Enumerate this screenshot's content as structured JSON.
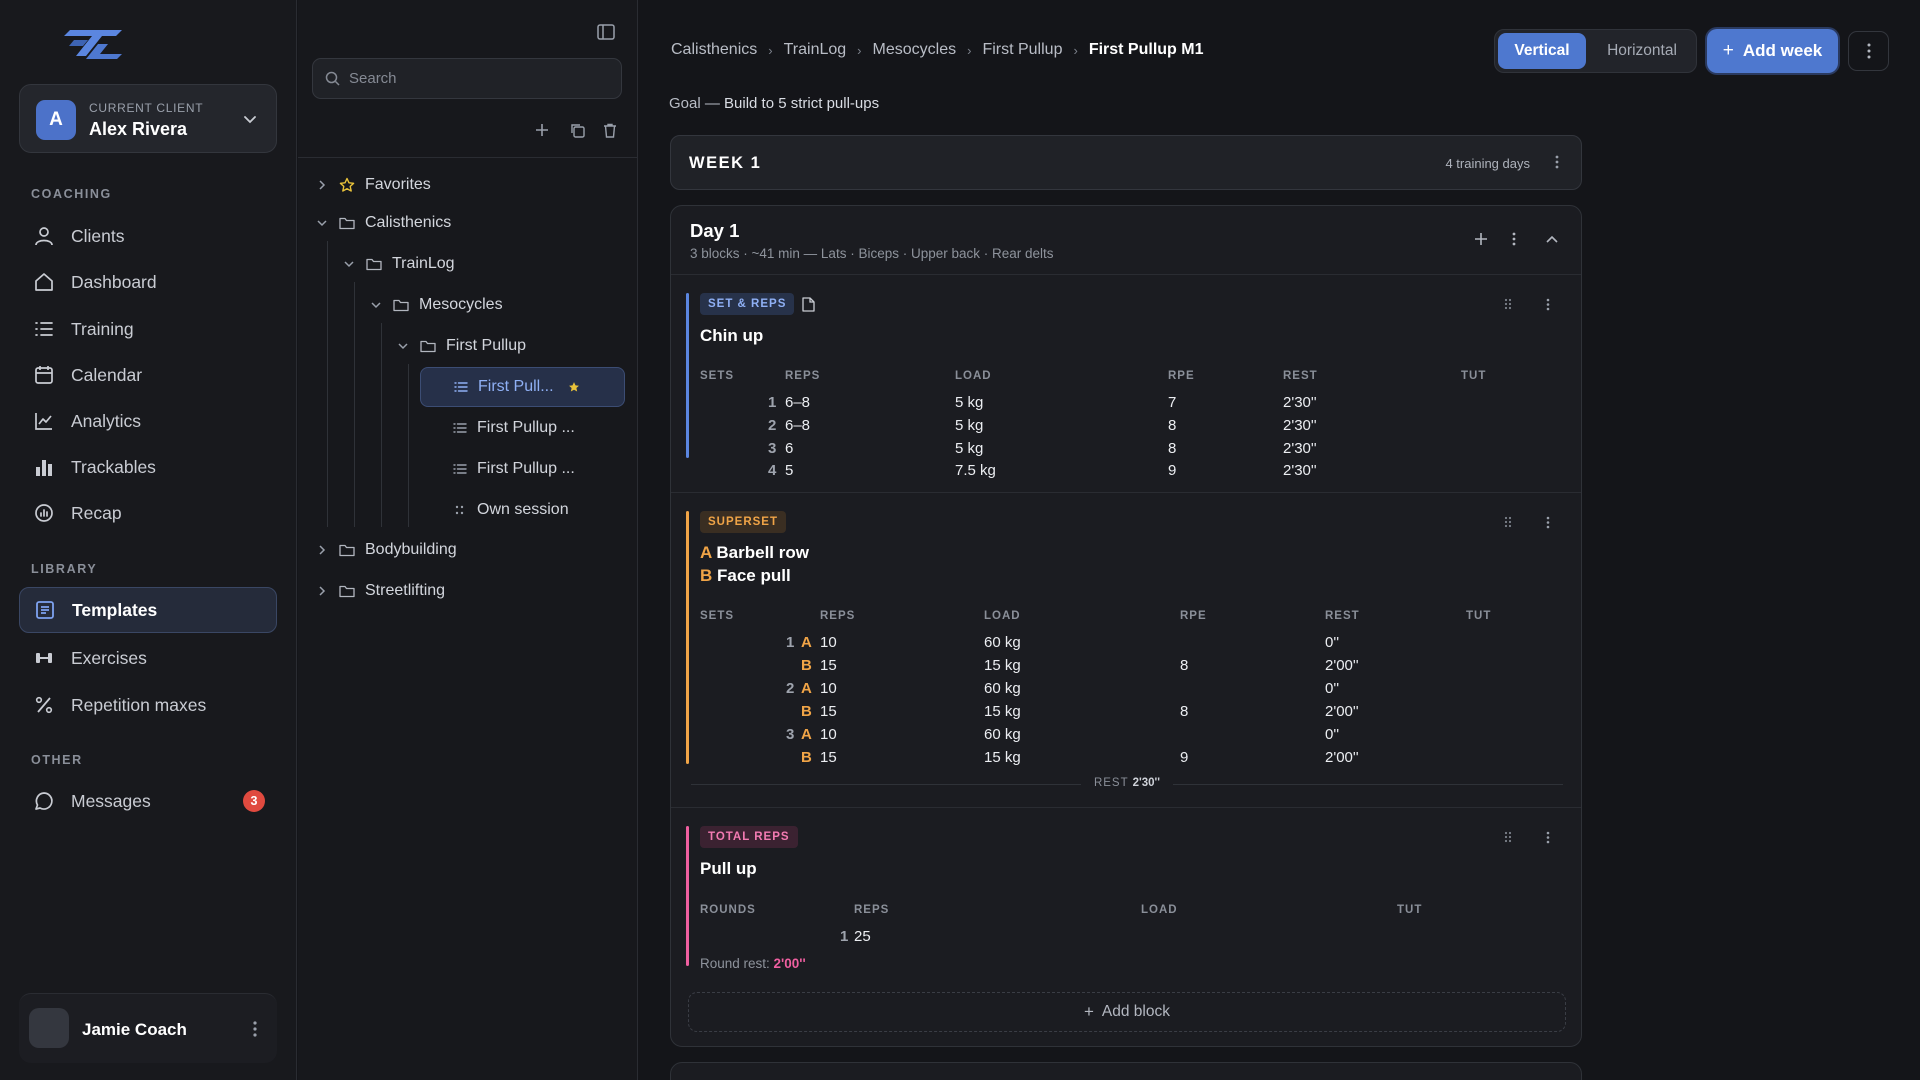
{
  "sidebar": {
    "client": {
      "label": "CURRENT CLIENT",
      "name": "Alex Rivera",
      "initial": "A"
    },
    "sections": {
      "coaching": "COACHING",
      "library": "LIBRARY",
      "other": "OTHER"
    },
    "nav": {
      "clients": "Clients",
      "dashboard": "Dashboard",
      "training": "Training",
      "calendar": "Calendar",
      "analytics": "Analytics",
      "trackables": "Trackables",
      "recap": "Recap",
      "templates": "Templates",
      "exercises": "Exercises",
      "repetition_maxes": "Repetition maxes",
      "messages": "Messages"
    },
    "messages_badge": "3",
    "user": {
      "name": "Jamie Coach"
    },
    "active_item": "Templates"
  },
  "tree": {
    "search_placeholder": "Search",
    "items": {
      "favorites": "Favorites",
      "calisthenics": "Calisthenics",
      "trainlog": "TrainLog",
      "mesocycles": "Mesocycles",
      "first_pullup": "First Pullup",
      "first_pullup_m1": "First Pull...",
      "first_pullup_m2": "First Pullup ...",
      "first_pullup_m3": "First Pullup ...",
      "own_session": "Own session",
      "bodybuilding": "Bodybuilding",
      "streetlifting": "Streetlifting"
    }
  },
  "main": {
    "breadcrumbs": [
      "Calisthenics",
      "TrainLog",
      "Mesocycles",
      "First Pullup",
      "First Pullup M1"
    ],
    "view_toggle": {
      "vertical": "Vertical",
      "horizontal": "Horizontal",
      "selected": "Vertical"
    },
    "add_week_label": "Add week",
    "goal_prefix": "Goal — ",
    "goal_text": "Build to 5 strict pull-ups",
    "week": {
      "title": "WEEK 1",
      "days": "4 training days"
    },
    "day": {
      "title": "Day 1",
      "subtitle": "3 blocks · ~41 min — Lats · Biceps · Upper back · Rear delts",
      "add_block_label": "Add block"
    },
    "blocks": {
      "chinup": {
        "tag": "SET & REPS",
        "name": "Chin up",
        "headers": {
          "sets": "SETS",
          "reps": "REPS",
          "load": "LOAD",
          "rpe": "RPE",
          "rest": "REST",
          "tut": "TUT"
        },
        "rows": [
          {
            "set": "1",
            "reps": "6–8",
            "load": "5 kg",
            "rpe": "7",
            "rest": "2'30''"
          },
          {
            "set": "2",
            "reps": "6–8",
            "load": "5 kg",
            "rpe": "8",
            "rest": "2'30''"
          },
          {
            "set": "3",
            "reps": "6",
            "load": "5 kg",
            "rpe": "8",
            "rest": "2'30''"
          },
          {
            "set": "4",
            "reps": "5",
            "load": "7.5 kg",
            "rpe": "9",
            "rest": "2'30''"
          }
        ]
      },
      "superset": {
        "tag": "SUPERSET",
        "exercise_a": {
          "letter": "A",
          "name": "Barbell row"
        },
        "exercise_b": {
          "letter": "B",
          "name": "Face pull"
        },
        "headers": {
          "sets": "SETS",
          "reps": "REPS",
          "load": "LOAD",
          "rpe": "RPE",
          "rest": "REST",
          "tut": "TUT"
        },
        "rows": [
          {
            "set": "1",
            "ex": "A",
            "reps": "10",
            "load": "60 kg",
            "rpe": "",
            "rest": "0''"
          },
          {
            "set": "",
            "ex": "B",
            "reps": "15",
            "load": "15 kg",
            "rpe": "8",
            "rest": "2'00''"
          },
          {
            "set": "2",
            "ex": "A",
            "reps": "10",
            "load": "60 kg",
            "rpe": "",
            "rest": "0''"
          },
          {
            "set": "",
            "ex": "B",
            "reps": "15",
            "load": "15 kg",
            "rpe": "8",
            "rest": "2'00''"
          },
          {
            "set": "3",
            "ex": "A",
            "reps": "10",
            "load": "60 kg",
            "rpe": "",
            "rest": "0''"
          },
          {
            "set": "",
            "ex": "B",
            "reps": "15",
            "load": "15 kg",
            "rpe": "9",
            "rest": "2'00''"
          }
        ],
        "rest_after_label": "REST",
        "rest_after_value": "2'30''"
      },
      "totalreps": {
        "tag": "TOTAL REPS",
        "name": "Pull up",
        "headers": {
          "rounds": "ROUNDS",
          "reps": "REPS",
          "load": "LOAD",
          "tut": "TUT"
        },
        "rows": [
          {
            "round": "1",
            "reps": "25"
          }
        ],
        "round_rest_label": "Round rest: ",
        "round_rest_value": "2'00''"
      }
    }
  },
  "colors": {
    "accent": "#4e78cf",
    "set_reps_bar": "#5b86e0",
    "superset_bar": "#f0a447",
    "total_reps_bar": "#ef5fa0",
    "badge": "#e04a3f"
  },
  "icons": {
    "logo": "tl-logo",
    "nav": [
      "user-icon",
      "home-icon",
      "list-icon",
      "calendar-icon",
      "chart-line-icon",
      "bar-chart-icon",
      "gauge-icon",
      "document-icon",
      "dumbbell-icon",
      "percent-icon",
      "message-icon"
    ]
  }
}
